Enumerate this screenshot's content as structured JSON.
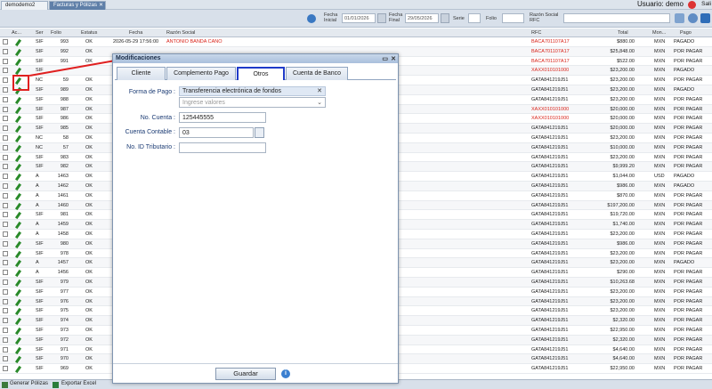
{
  "tabs": [
    {
      "label": "demodemo2"
    },
    {
      "label": "Facturas y Pólizas"
    }
  ],
  "user_label": "Usuario: demo",
  "salir_label": "Sali",
  "filters": {
    "fecha_inicial_label": "Fecha Inicial",
    "fecha_inicial_value": "01/01/2026",
    "fecha_final_label": "Fecha Final",
    "fecha_final_value": "29/05/2026",
    "serie_label": "Serie",
    "folio_label": "Folio",
    "razon_label": "Razón Social RFC"
  },
  "columns": [
    "Ac...",
    "Ser",
    "Folio",
    "Estatus",
    "Fecha",
    "Razón Social",
    "RFC",
    "Total",
    "Mon...",
    "Pago"
  ],
  "rows": [
    {
      "ser": "SIF",
      "folio": "993",
      "estatus": "OK",
      "fecha": "2026-05-29 17:56:00",
      "razon": "ANTONIO BANDA CANO",
      "rfc": "BACA701107A17",
      "total": "$880.00",
      "mon": "MXN",
      "pago": "PAGADO",
      "red": true
    },
    {
      "ser": "SIF",
      "folio": "992",
      "estatus": "OK",
      "fecha": "",
      "razon": "",
      "rfc": "BACA701107A17",
      "total": "$25,848.00",
      "mon": "MXN",
      "pago": "POR PAGAR",
      "red": true
    },
    {
      "ser": "SIF",
      "folio": "991",
      "estatus": "OK",
      "fecha": "",
      "razon": "",
      "rfc": "BACA701107A17",
      "total": "$522.00",
      "mon": "MXN",
      "pago": "POR PAGAR",
      "red": true
    },
    {
      "ser": "SIF",
      "folio": "",
      "estatus": "",
      "fecha": "",
      "razon": "",
      "rfc": "XAXX010101000",
      "total": "$23,200.00",
      "mon": "MXN",
      "pago": "PAGADO",
      "red": true
    },
    {
      "ser": "NC",
      "folio": "59",
      "estatus": "OK",
      "fecha": "",
      "razon": "",
      "rfc": "GATA841219J51",
      "total": "$23,200.00",
      "mon": "MXN",
      "pago": "POR PAGAR",
      "red": false
    },
    {
      "ser": "SIF",
      "folio": "989",
      "estatus": "OK",
      "fecha": "",
      "razon": "",
      "rfc": "GATA841219J51",
      "total": "$23,200.00",
      "mon": "MXN",
      "pago": "PAGADO",
      "red": false
    },
    {
      "ser": "SIF",
      "folio": "988",
      "estatus": "OK",
      "fecha": "",
      "razon": "",
      "rfc": "GATA841219J51",
      "total": "$23,200.00",
      "mon": "MXN",
      "pago": "POR PAGAR",
      "red": false
    },
    {
      "ser": "SIF",
      "folio": "987",
      "estatus": "OK",
      "fecha": "",
      "razon": "",
      "rfc": "XAXX010101000",
      "total": "$20,000.00",
      "mon": "MXN",
      "pago": "POR PAGAR",
      "red": true
    },
    {
      "ser": "SIF",
      "folio": "986",
      "estatus": "OK",
      "fecha": "",
      "razon": "",
      "rfc": "XAXX010101000",
      "total": "$20,000.00",
      "mon": "MXN",
      "pago": "POR PAGAR",
      "red": true
    },
    {
      "ser": "SIF",
      "folio": "985",
      "estatus": "OK",
      "fecha": "",
      "razon": "",
      "rfc": "GATA841219J51",
      "total": "$20,000.00",
      "mon": "MXN",
      "pago": "POR PAGAR",
      "red": false
    },
    {
      "ser": "NC",
      "folio": "58",
      "estatus": "OK",
      "fecha": "",
      "razon": "",
      "rfc": "GATA841219J51",
      "total": "$23,200.00",
      "mon": "MXN",
      "pago": "POR PAGAR",
      "red": false
    },
    {
      "ser": "NC",
      "folio": "57",
      "estatus": "OK",
      "fecha": "",
      "razon": "",
      "rfc": "GATA841219J51",
      "total": "$10,000.00",
      "mon": "MXN",
      "pago": "POR PAGAR",
      "red": false
    },
    {
      "ser": "SIF",
      "folio": "983",
      "estatus": "OK",
      "fecha": "",
      "razon": "",
      "rfc": "GATA841219J51",
      "total": "$23,200.00",
      "mon": "MXN",
      "pago": "POR PAGAR",
      "red": false
    },
    {
      "ser": "SIF",
      "folio": "982",
      "estatus": "OK",
      "fecha": "",
      "razon": "",
      "rfc": "GATA841219J51",
      "total": "$9,999.20",
      "mon": "MXN",
      "pago": "POR PAGAR",
      "red": false
    },
    {
      "ser": "A",
      "folio": "1463",
      "estatus": "OK",
      "fecha": "",
      "razon": "",
      "rfc": "GATA841219J51",
      "total": "$1,044.00",
      "mon": "USD",
      "pago": "PAGADO",
      "red": false
    },
    {
      "ser": "A",
      "folio": "1462",
      "estatus": "OK",
      "fecha": "",
      "razon": "",
      "rfc": "GATA841219J51",
      "total": "$986.00",
      "mon": "MXN",
      "pago": "PAGADO",
      "red": false
    },
    {
      "ser": "A",
      "folio": "1461",
      "estatus": "OK",
      "fecha": "",
      "razon": "",
      "rfc": "GATA841219J51",
      "total": "$870.00",
      "mon": "MXN",
      "pago": "POR PAGAR",
      "red": false
    },
    {
      "ser": "A",
      "folio": "1460",
      "estatus": "OK",
      "fecha": "",
      "razon": "",
      "rfc": "GATA841219J51",
      "total": "$197,200.00",
      "mon": "MXN",
      "pago": "POR PAGAR",
      "red": false
    },
    {
      "ser": "SIF",
      "folio": "981",
      "estatus": "OK",
      "fecha": "",
      "razon": "",
      "rfc": "GATA841219J51",
      "total": "$19,720.00",
      "mon": "MXN",
      "pago": "POR PAGAR",
      "red": false
    },
    {
      "ser": "A",
      "folio": "1459",
      "estatus": "OK",
      "fecha": "",
      "razon": "",
      "rfc": "GATA841219J51",
      "total": "$1,740.00",
      "mon": "MXN",
      "pago": "POR PAGAR",
      "red": false
    },
    {
      "ser": "A",
      "folio": "1458",
      "estatus": "OK",
      "fecha": "",
      "razon": "",
      "rfc": "GATA841219J51",
      "total": "$23,200.00",
      "mon": "MXN",
      "pago": "POR PAGAR",
      "red": false
    },
    {
      "ser": "SIF",
      "folio": "980",
      "estatus": "OK",
      "fecha": "",
      "razon": "",
      "rfc": "GATA841219J51",
      "total": "$986.00",
      "mon": "MXN",
      "pago": "POR PAGAR",
      "red": false
    },
    {
      "ser": "SIF",
      "folio": "978",
      "estatus": "OK",
      "fecha": "",
      "razon": "",
      "rfc": "GATA841219J51",
      "total": "$23,200.00",
      "mon": "MXN",
      "pago": "POR PAGAR",
      "red": false
    },
    {
      "ser": "A",
      "folio": "1457",
      "estatus": "OK",
      "fecha": "",
      "razon": "",
      "rfc": "GATA841219J51",
      "total": "$23,200.00",
      "mon": "MXN",
      "pago": "PAGADO",
      "red": false
    },
    {
      "ser": "A",
      "folio": "1456",
      "estatus": "OK",
      "fecha": "",
      "razon": "",
      "rfc": "GATA841219J51",
      "total": "$290.00",
      "mon": "MXN",
      "pago": "POR PAGAR",
      "red": false
    },
    {
      "ser": "SIF",
      "folio": "979",
      "estatus": "OK",
      "fecha": "",
      "razon": "",
      "rfc": "GATA841219J51",
      "total": "$10,263.68",
      "mon": "MXN",
      "pago": "POR PAGAR",
      "red": false
    },
    {
      "ser": "SIF",
      "folio": "977",
      "estatus": "OK",
      "fecha": "",
      "razon": "",
      "rfc": "GATA841219J51",
      "total": "$23,200.00",
      "mon": "MXN",
      "pago": "POR PAGAR",
      "red": false
    },
    {
      "ser": "SIF",
      "folio": "976",
      "estatus": "OK",
      "fecha": "",
      "razon": "",
      "rfc": "GATA841219J51",
      "total": "$23,200.00",
      "mon": "MXN",
      "pago": "POR PAGAR",
      "red": false
    },
    {
      "ser": "SIF",
      "folio": "975",
      "estatus": "OK",
      "fecha": "",
      "razon": "",
      "rfc": "GATA841219J51",
      "total": "$23,200.00",
      "mon": "MXN",
      "pago": "POR PAGAR",
      "red": false
    },
    {
      "ser": "SIF",
      "folio": "974",
      "estatus": "OK",
      "fecha": "",
      "razon": "",
      "rfc": "GATA841219J51",
      "total": "$2,320.00",
      "mon": "MXN",
      "pago": "POR PAGAR",
      "red": false
    },
    {
      "ser": "SIF",
      "folio": "973",
      "estatus": "OK",
      "fecha": "",
      "razon": "",
      "rfc": "GATA841219J51",
      "total": "$22,950.00",
      "mon": "MXN",
      "pago": "POR PAGAR",
      "red": false
    },
    {
      "ser": "SIF",
      "folio": "972",
      "estatus": "OK",
      "fecha": "",
      "razon": "",
      "rfc": "GATA841219J51",
      "total": "$2,320.00",
      "mon": "MXN",
      "pago": "POR PAGAR",
      "red": false
    },
    {
      "ser": "SIF",
      "folio": "971",
      "estatus": "OK",
      "fecha": "",
      "razon": "",
      "rfc": "GATA841219J51",
      "total": "$4,640.00",
      "mon": "MXN",
      "pago": "POR PAGAR",
      "red": false
    },
    {
      "ser": "SIF",
      "folio": "970",
      "estatus": "OK",
      "fecha": "",
      "razon": "",
      "rfc": "GATA841219J51",
      "total": "$4,640.00",
      "mon": "MXN",
      "pago": "POR PAGAR",
      "red": false
    },
    {
      "ser": "SIF",
      "folio": "969",
      "estatus": "OK",
      "fecha": "",
      "razon": "",
      "rfc": "GATA841219J51",
      "total": "$22,950.00",
      "mon": "MXN",
      "pago": "POR PAGAR",
      "red": false
    }
  ],
  "bottom": {
    "generar": "Generar Pólizas",
    "exportar": "Exportar Excel"
  },
  "dialog": {
    "title": "Modificaciones",
    "tabs": [
      "Cliente",
      "Complemento Pago",
      "Otros",
      "Cuenta de Banco"
    ],
    "forma_label": "Forma de Pago :",
    "forma_tag": "Transferencia electrónica de fondos",
    "forma_placeholder": "Ingrese valores",
    "cuenta_label": "No. Cuenta :",
    "cuenta_value": "125445555",
    "contable_label": "Cuenta Contable :",
    "contable_value": "03",
    "tributario_label": "No. ID Tributario :",
    "tributario_value": "",
    "guardar": "Guardar"
  },
  "colors": {
    "accent": "#1f3bc9",
    "red": "#d9241a",
    "pen": "#2a8a2a"
  }
}
